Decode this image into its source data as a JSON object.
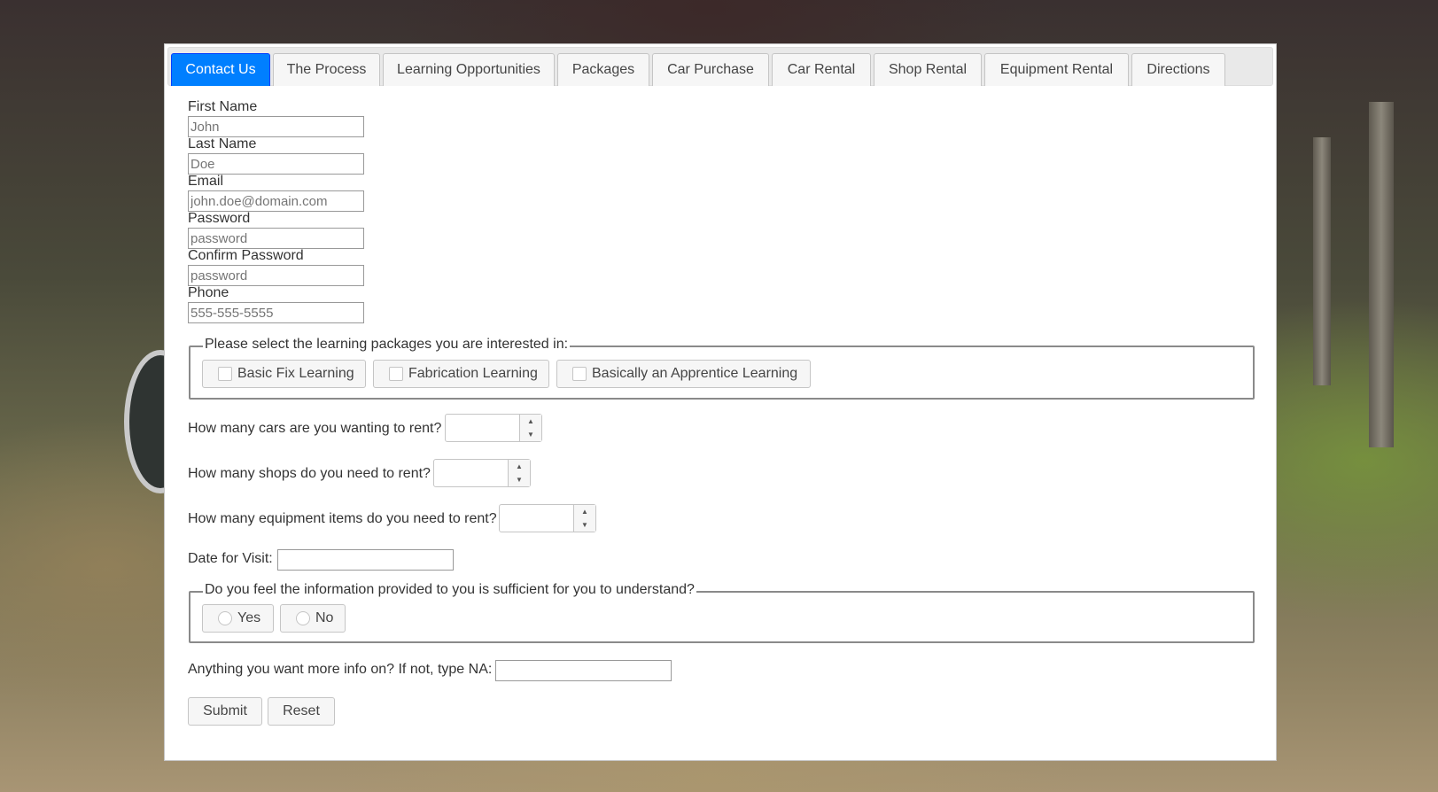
{
  "tabs": [
    {
      "label": "Contact Us",
      "active": true
    },
    {
      "label": "The Process"
    },
    {
      "label": "Learning Opportunities"
    },
    {
      "label": "Packages"
    },
    {
      "label": "Car Purchase"
    },
    {
      "label": "Car Rental"
    },
    {
      "label": "Shop Rental"
    },
    {
      "label": "Equipment Rental"
    },
    {
      "label": "Directions"
    }
  ],
  "form": {
    "first_name": {
      "label": "First Name",
      "placeholder": "John"
    },
    "last_name": {
      "label": "Last Name",
      "placeholder": "Doe"
    },
    "email": {
      "label": "Email",
      "placeholder": "john.doe@domain.com"
    },
    "password": {
      "label": "Password",
      "placeholder": "password"
    },
    "confirm_password": {
      "label": "Confirm Password",
      "placeholder": "password"
    },
    "phone": {
      "label": "Phone",
      "placeholder": "555-555-5555"
    }
  },
  "packages": {
    "legend": "Please select the learning packages you are interested in:",
    "options": [
      "Basic Fix Learning",
      "Fabrication Learning",
      "Basically an Apprentice Learning"
    ]
  },
  "rentals": {
    "cars_label": "How many cars are you wanting to rent?",
    "shops_label": "How many shops do you need to rent?",
    "equipment_label": "How many equipment items do you need to rent?"
  },
  "visit": {
    "label": "Date for Visit:"
  },
  "sufficient": {
    "legend": "Do you feel the information provided to you is sufficient for you to understand?",
    "options": [
      "Yes",
      "No"
    ]
  },
  "more_info": {
    "label": "Anything you want more info on? If not, type NA:"
  },
  "actions": {
    "submit": "Submit",
    "reset": "Reset"
  },
  "colors": {
    "active_tab": "#007fff",
    "panel_bg": "#ffffff"
  }
}
